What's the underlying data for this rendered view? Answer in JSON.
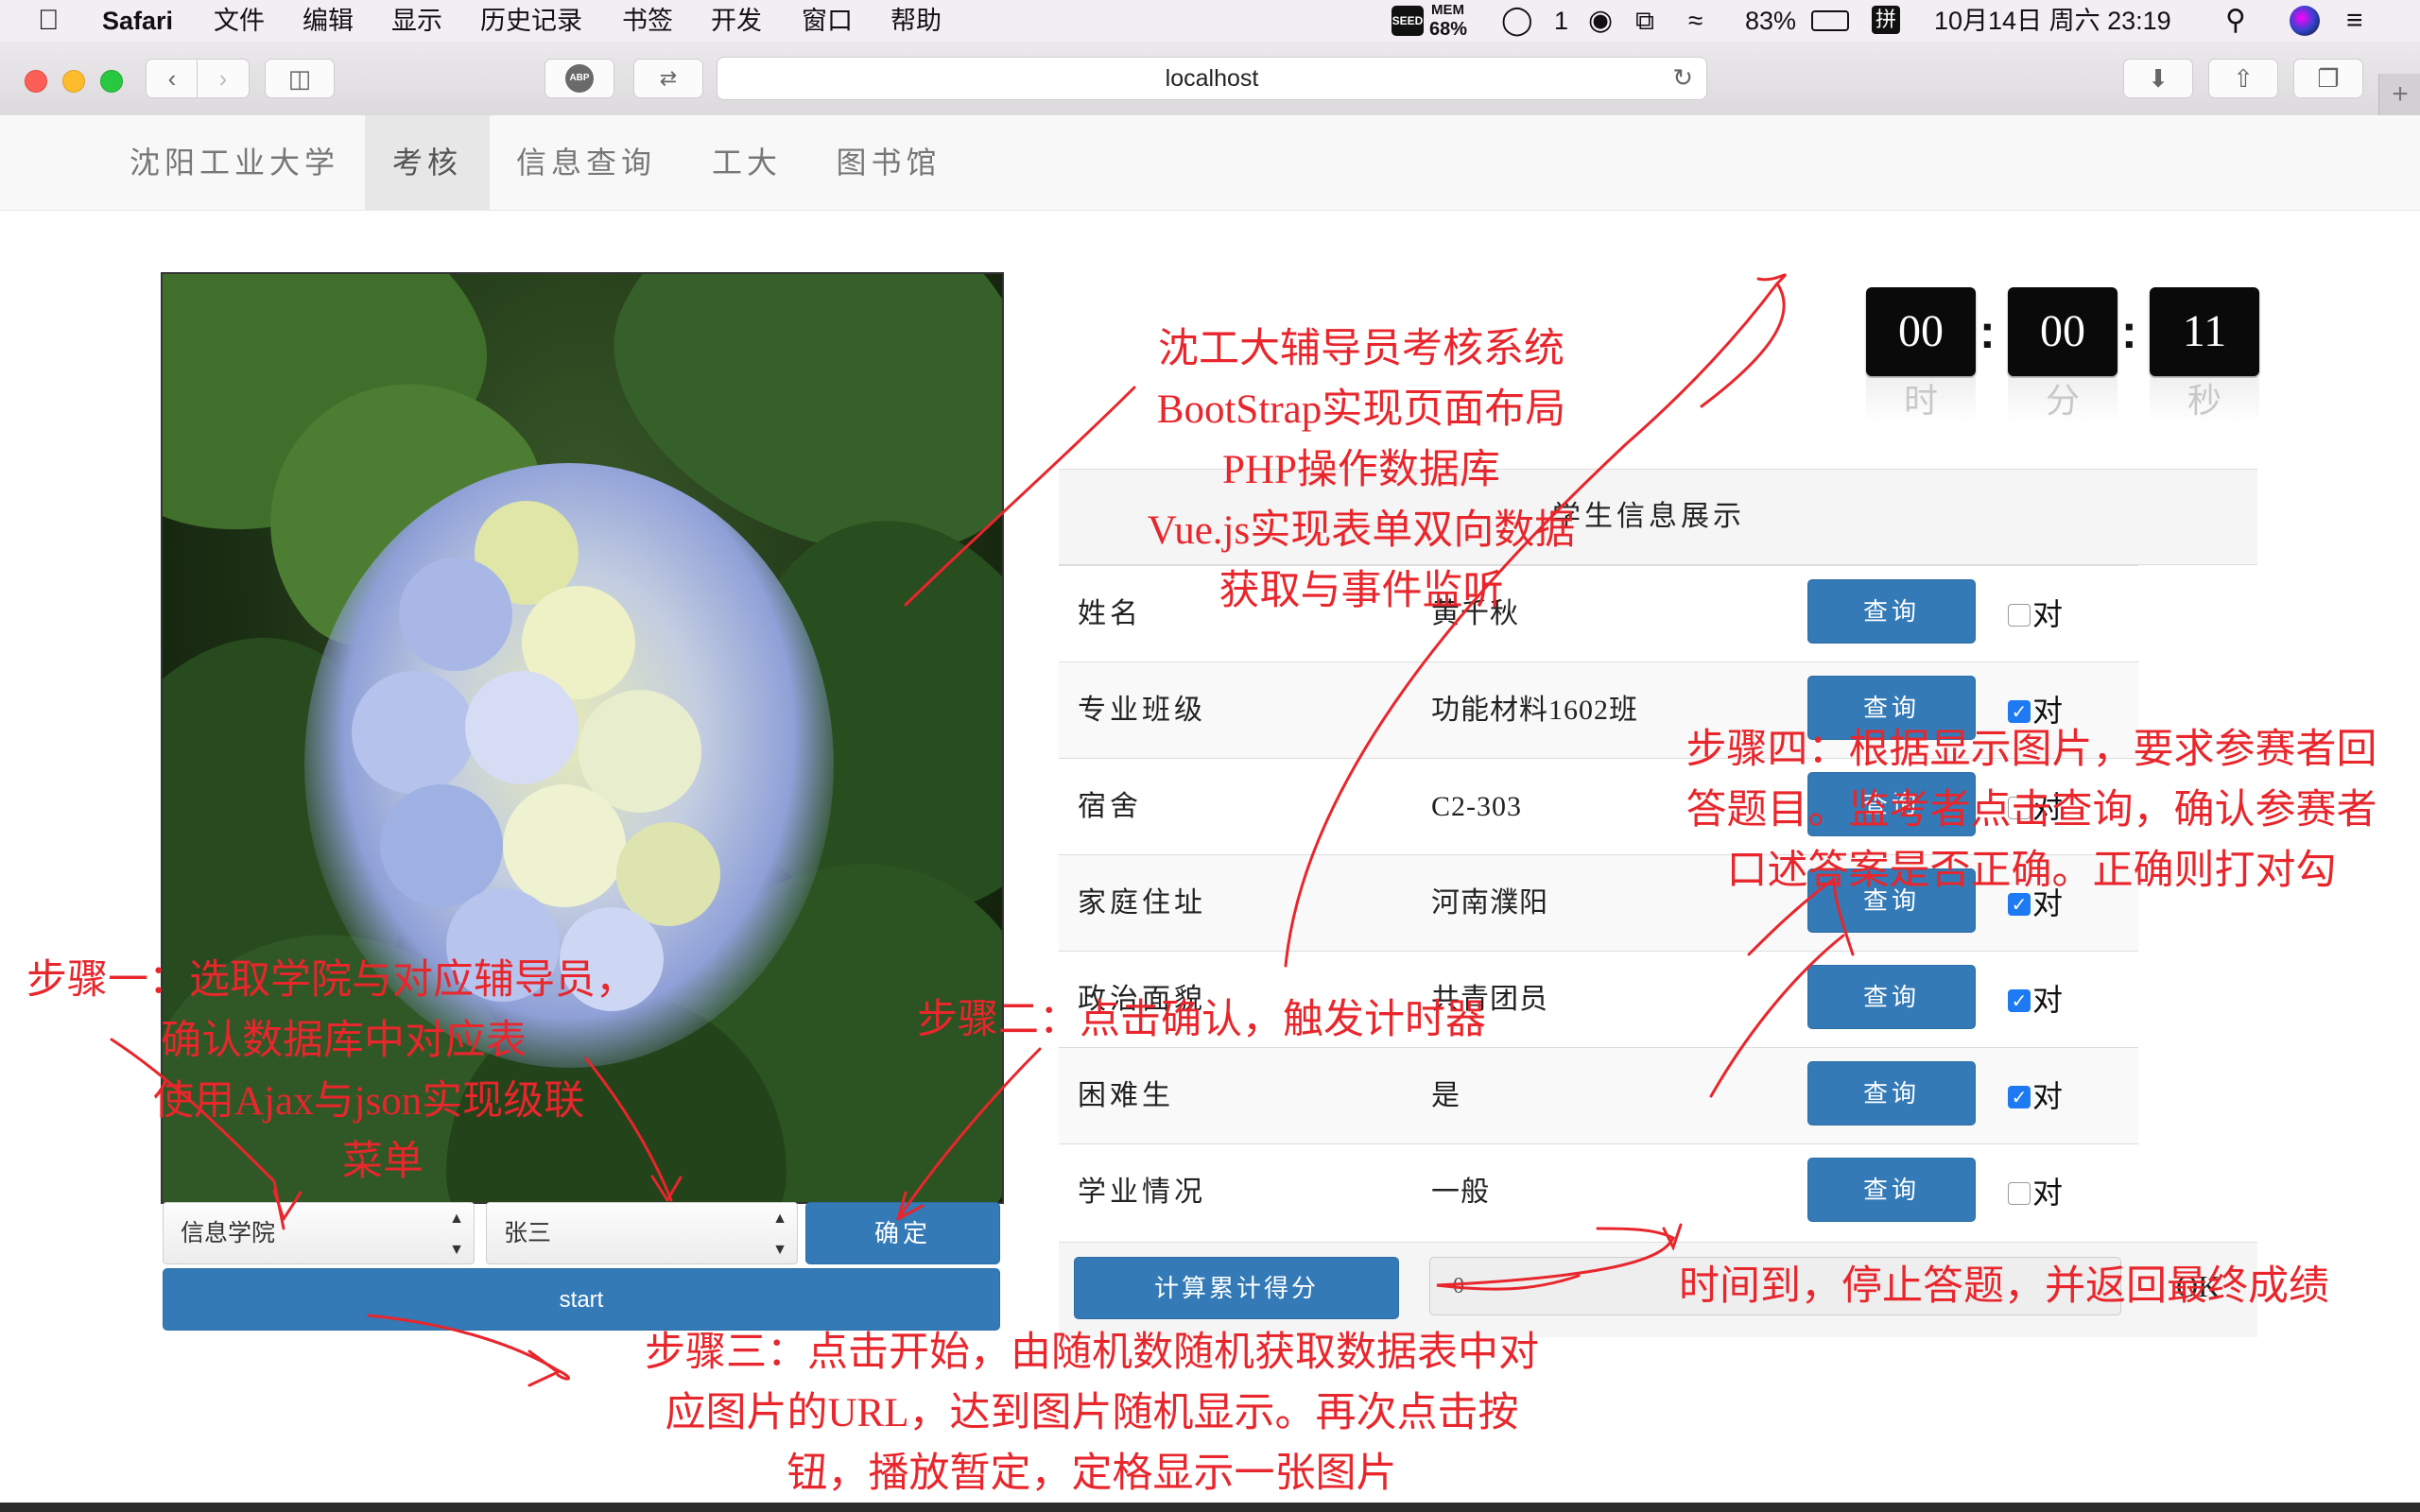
{
  "menubar": {
    "app": "Safari",
    "items": [
      "文件",
      "编辑",
      "显示",
      "历史记录",
      "书签",
      "开发",
      "窗口",
      "帮助"
    ],
    "status": {
      "seed": "SEED",
      "mem_label": "MEM",
      "mem_value": "68%",
      "wechat_count": "1",
      "battery": "83%",
      "ime": "拼",
      "datetime": "10月14日 周六  23:19"
    }
  },
  "browser": {
    "url": "localhost",
    "abp": "ABP"
  },
  "navbar": {
    "brand": "沈阳工业大学",
    "items": [
      {
        "label": "考核",
        "active": true
      },
      {
        "label": "信息查询",
        "active": false
      },
      {
        "label": "工大",
        "active": false
      },
      {
        "label": "图书馆",
        "active": false
      }
    ]
  },
  "controls": {
    "college_select": "信息学院",
    "counselor_select": "张三",
    "confirm_label": "确定",
    "start_label": "start"
  },
  "timer": {
    "hours": "00",
    "minutes": "00",
    "seconds": "11",
    "hours_unit": "时",
    "minutes_unit": "分",
    "seconds_unit": "秒"
  },
  "table": {
    "title": "学生信息展示",
    "query_label": "查询",
    "correct_label": "对",
    "rows": [
      {
        "label": "姓名",
        "value": "黄千秋",
        "checked": false
      },
      {
        "label": "专业班级",
        "value": "功能材料1602班",
        "checked": true
      },
      {
        "label": "宿舍",
        "value": "C2-303",
        "checked": false
      },
      {
        "label": "家庭住址",
        "value": "河南濮阳",
        "checked": true
      },
      {
        "label": "政治面貌",
        "value": "共青团员",
        "checked": true
      },
      {
        "label": "困难生",
        "value": "是",
        "checked": true
      },
      {
        "label": "学业情况",
        "value": "一般",
        "checked": false
      }
    ],
    "calc_label": "计算累计得分",
    "score_value": "0",
    "score_suffix": "OK"
  },
  "annotations": {
    "title_block": [
      "沈工大辅导员考核系统",
      "BootStrap实现页面布局",
      "PHP操作数据库",
      "Vue.js实现表单双向数据",
      "获取与事件监听"
    ],
    "step1": [
      "步骤一：选取学院与对应辅导员，",
      "确认数据库中对应表",
      "使用Ajax与json实现级联",
      "菜单"
    ],
    "step2": "步骤二：点击确认，触发计时器",
    "step3": [
      "步骤三：点击开始，由随机数随机获取数据表中对",
      "应图片的URL，达到图片随机显示。再次点击按",
      "钮，播放暂定，定格显示一张图片"
    ],
    "step4": [
      "步骤四：根据显示图片，要求参赛者回",
      "答题目。监考者点击查询，确认参赛者",
      "口述答案是否正确。正确则打对勾"
    ],
    "step5": "时间到，停止答题，并返回最终成绩"
  },
  "colors": {
    "primary": "#337ab7",
    "annotation": "#e8262c",
    "navbar_bg": "#f8f8f8",
    "active_nav": "#e7e7e7",
    "checkbox_on": "#1d7af3"
  }
}
